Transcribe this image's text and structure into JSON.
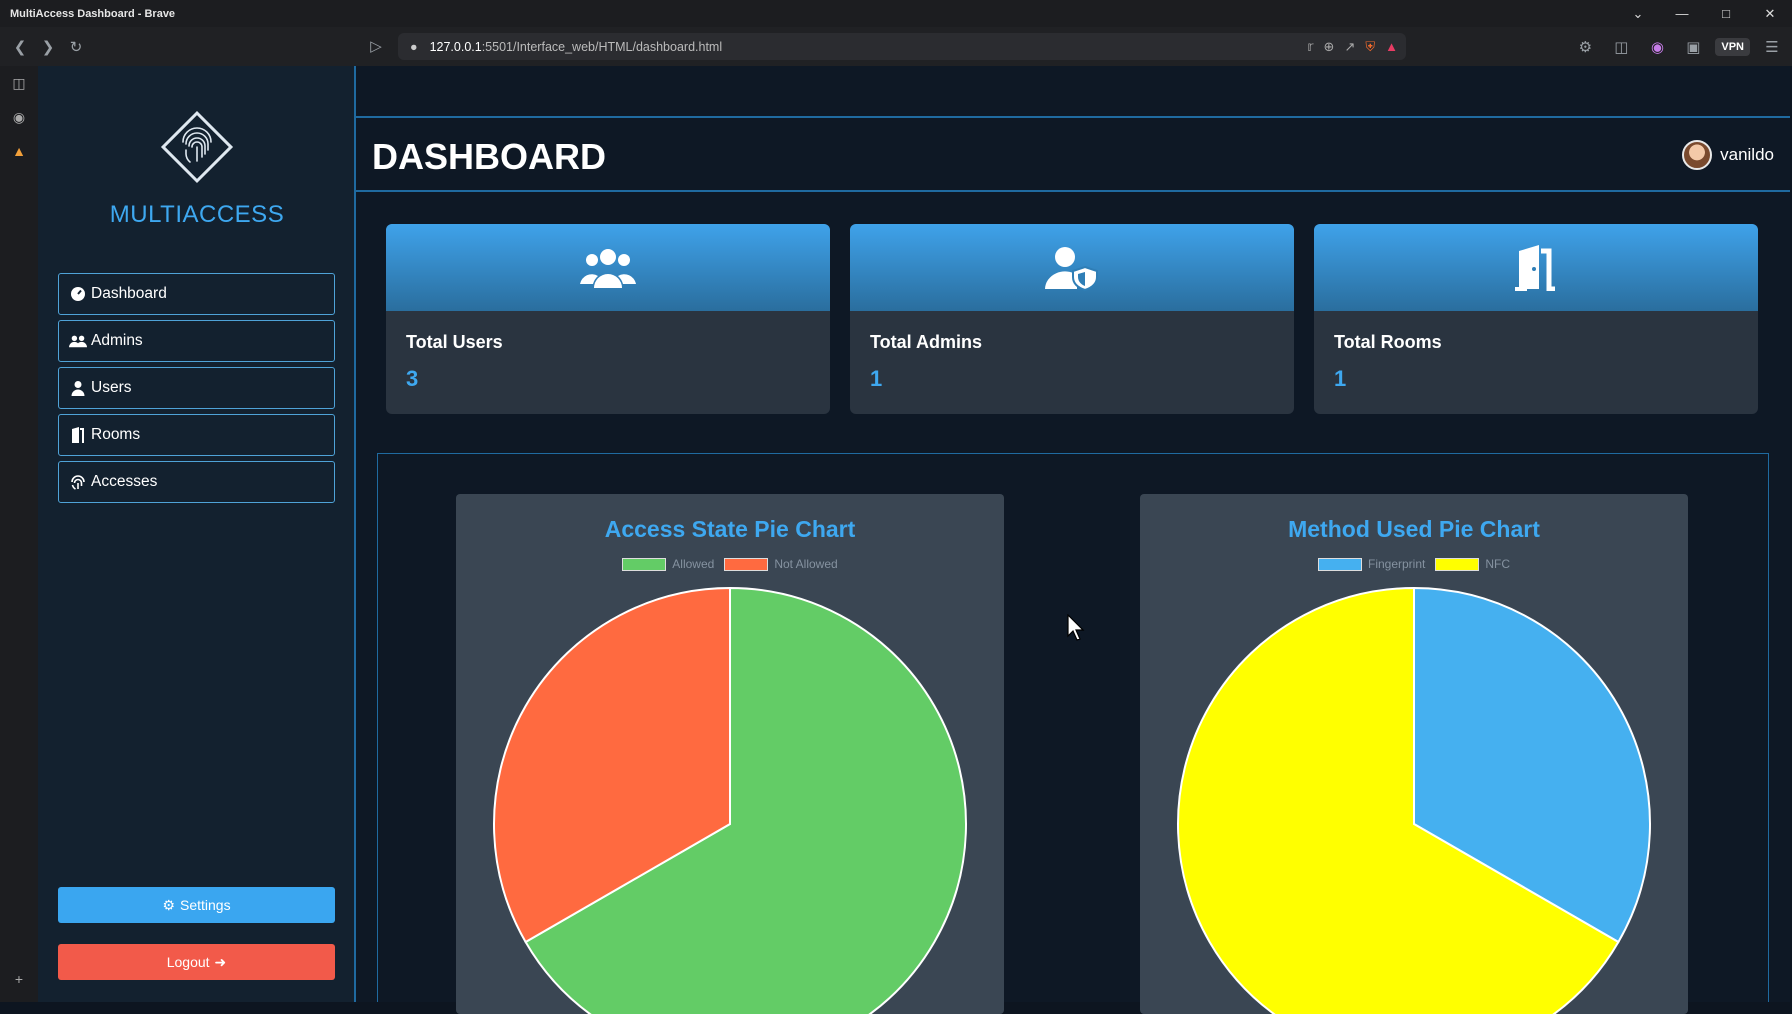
{
  "browser": {
    "window_title": "MultiAccess Dashboard - Brave",
    "url_host": "127.0.0.1",
    "url_rest": ":5501/Interface_web/HTML/dashboard.html",
    "vpn_label": "VPN"
  },
  "sidebar": {
    "brand": "MULTIACCESS",
    "items": [
      {
        "label": "Dashboard",
        "icon": "gauge-icon"
      },
      {
        "label": "Admins",
        "icon": "users-icon"
      },
      {
        "label": "Users",
        "icon": "user-icon"
      },
      {
        "label": "Rooms",
        "icon": "door-icon"
      },
      {
        "label": "Accesses",
        "icon": "fingerprint-icon"
      }
    ],
    "settings_label": "Settings",
    "logout_label": "Logout"
  },
  "header": {
    "title": "DASHBOARD",
    "username": "vanildo"
  },
  "cards": [
    {
      "label": "Total Users",
      "value": "3",
      "icon": "users-icon"
    },
    {
      "label": "Total Admins",
      "value": "1",
      "icon": "user-shield-icon"
    },
    {
      "label": "Total Rooms",
      "value": "1",
      "icon": "door-open-icon"
    }
  ],
  "colors": {
    "accent": "#3ea8f0",
    "allowed": "#63cc66",
    "not_allowed": "#ff6a40",
    "fingerprint": "#45b0f0",
    "nfc": "#ffff00",
    "logout": "#f25a4a"
  },
  "chart_data": [
    {
      "type": "pie",
      "title": "Access State Pie Chart",
      "categories": [
        "Allowed",
        "Not Allowed"
      ],
      "values": [
        6,
        3
      ],
      "colors": [
        "#63cc66",
        "#ff6a40"
      ],
      "legend": "top"
    },
    {
      "type": "pie",
      "title": "Method Used Pie Chart",
      "categories": [
        "Fingerprint",
        "NFC"
      ],
      "values": [
        1,
        2
      ],
      "colors": [
        "#45b0f0",
        "#ffff00"
      ],
      "legend": "top"
    }
  ]
}
